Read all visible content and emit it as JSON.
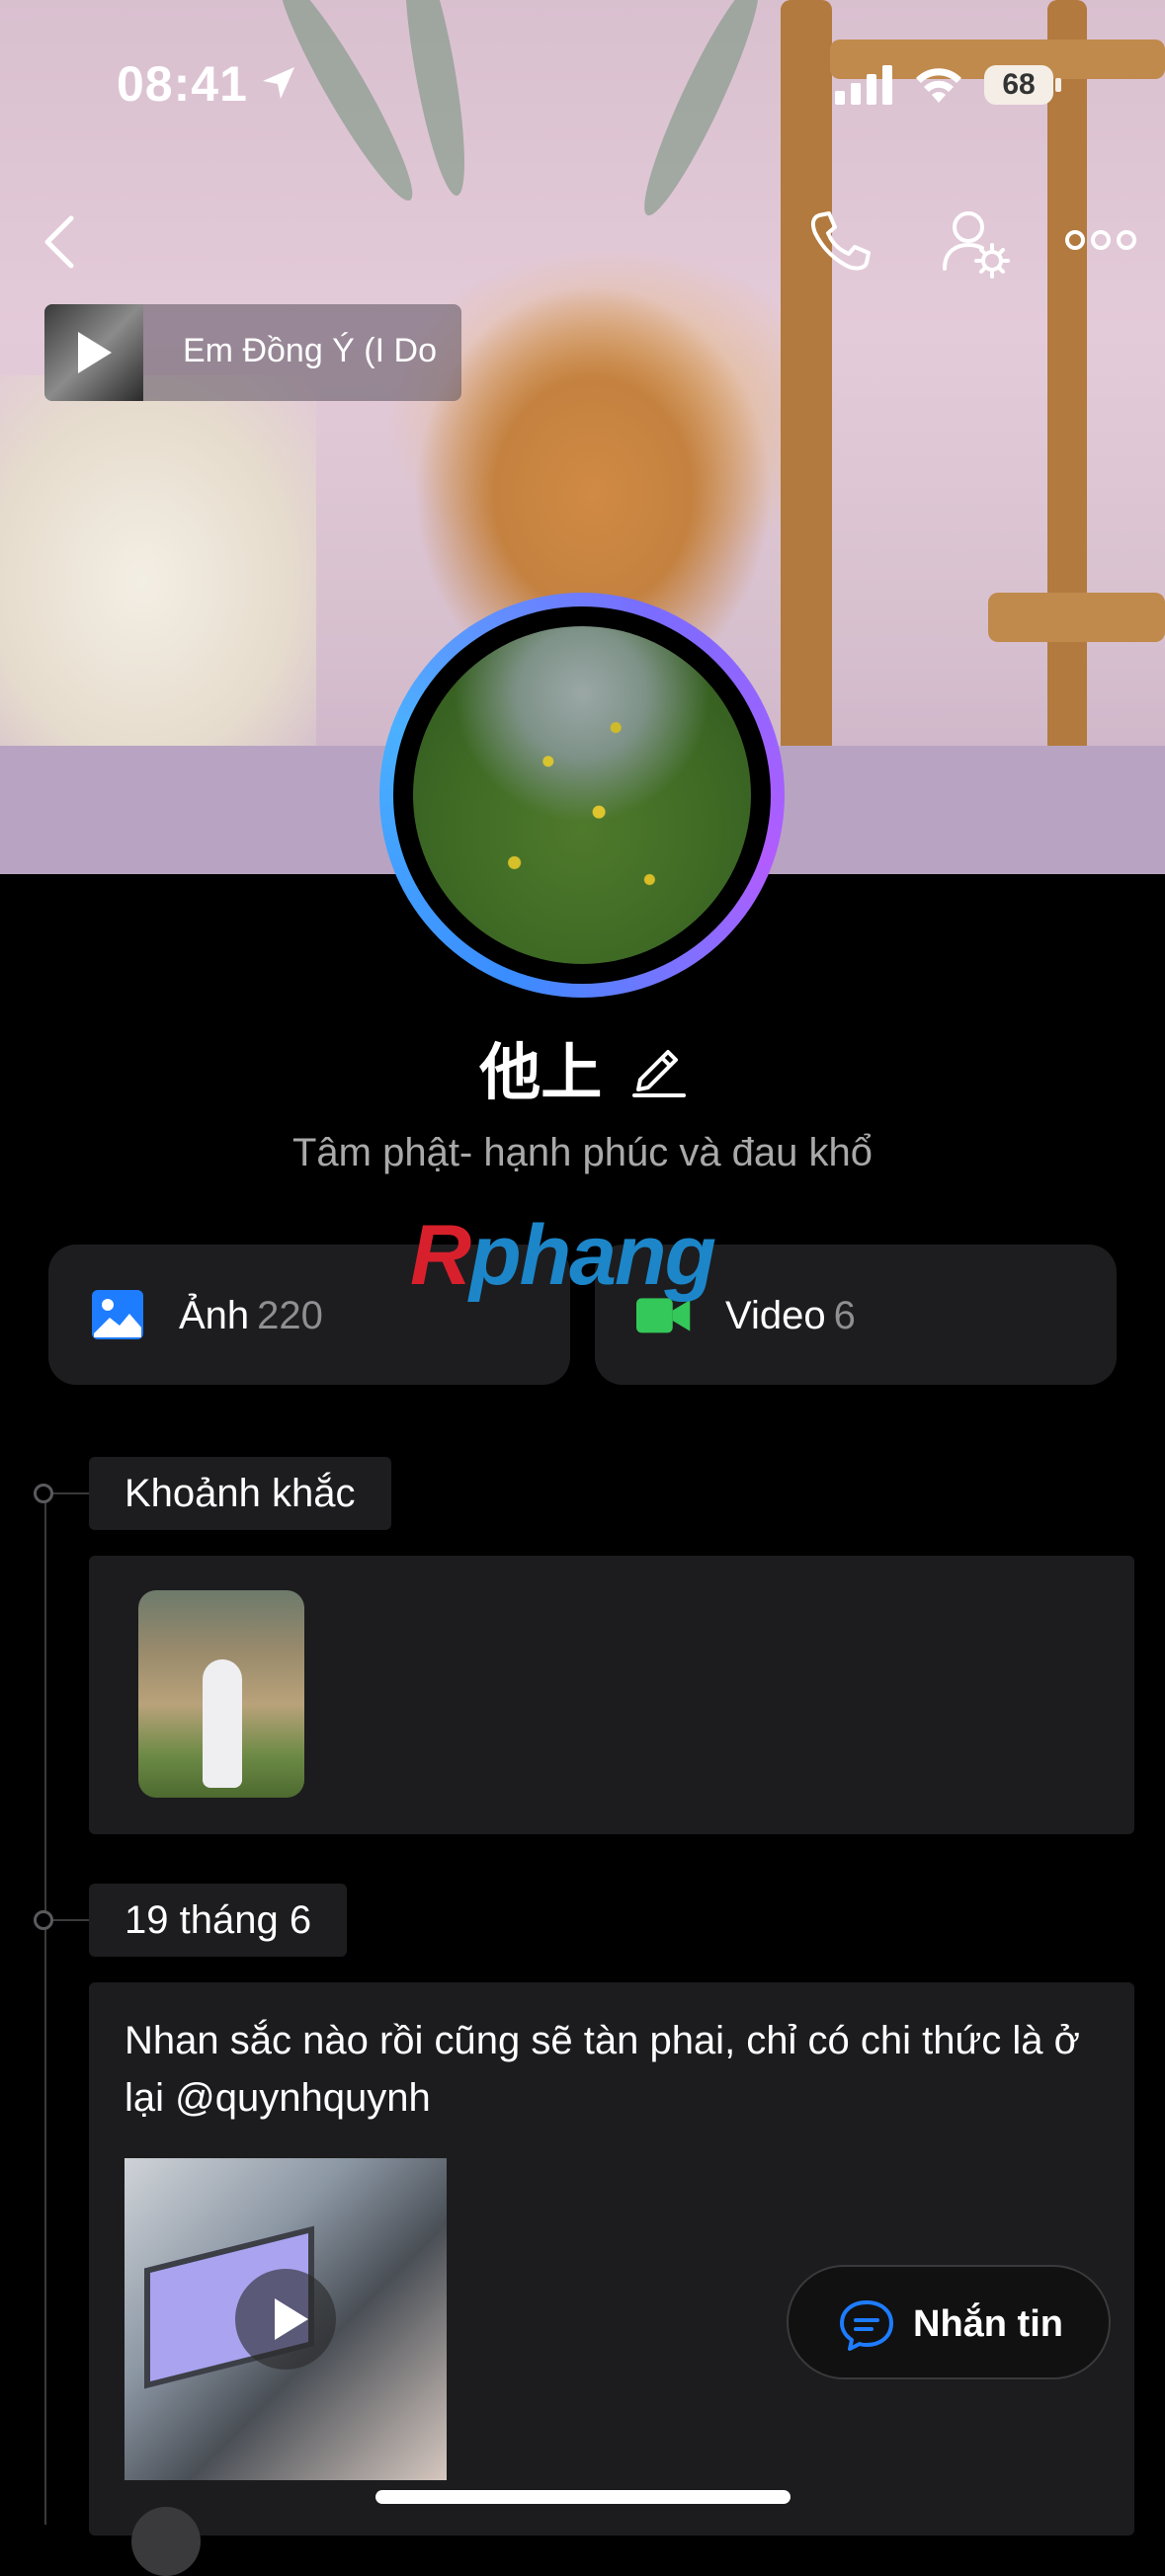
{
  "status_bar": {
    "time": "08:41",
    "battery": "68"
  },
  "header": {
    "music": {
      "title": "Em Đồng Ý (I Do"
    }
  },
  "profile": {
    "name": "他上",
    "bio": "Tâm phật- hạnh phúc và đau khổ"
  },
  "watermark": {
    "first": "R",
    "rest": "phang"
  },
  "media_tiles": {
    "photos": {
      "label": "Ảnh",
      "count": "220"
    },
    "videos": {
      "label": "Video",
      "count": "6"
    }
  },
  "timeline": {
    "moments_tag": "Khoảnh khắc",
    "date_tag": "19 tháng 6",
    "post_text": "Nhan sắc nào rồi cũng sẽ tàn phai, chỉ có chi thức là ở lại @quynhquynh"
  },
  "message_button": {
    "label": "Nhắn tin"
  },
  "colors": {
    "accent": "#1e7cff",
    "video_green": "#34c759",
    "background": "#000000",
    "card": "#1c1c1e"
  }
}
